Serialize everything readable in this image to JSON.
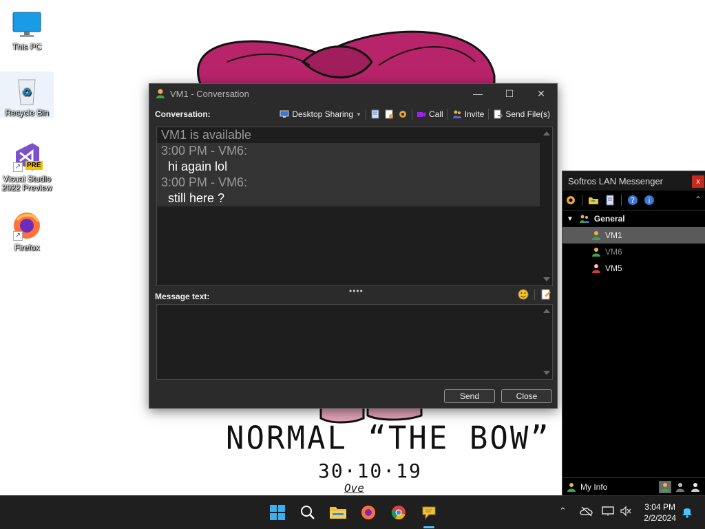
{
  "desktop": {
    "icons": [
      {
        "label": "This PC"
      },
      {
        "label": "Recycle Bin"
      },
      {
        "label": "Visual Studio 2022 Preview",
        "badge": "PRE"
      },
      {
        "label": "Firefox"
      }
    ]
  },
  "wallpaper": {
    "caption": "NORMAL “THE BOW”",
    "date": "30·10·19",
    "signature": "Ove"
  },
  "conversation_window": {
    "title": "VM1 - Conversation",
    "controls": {
      "minimize": "—",
      "maximize": "☐",
      "close": "✕"
    },
    "conversation_label": "Conversation:",
    "toolbar": {
      "desktop_sharing": "Desktop Sharing",
      "call": "Call",
      "invite": "Invite",
      "send_files": "Send File(s)"
    },
    "lines": {
      "status": "VM1 is available",
      "head1": "3:00 PM - VM6:",
      "msg1": "hi again lol",
      "head2": "3:00 PM - VM6:",
      "msg2": "still here ?"
    },
    "grip": "••••",
    "message_label": "Message text:",
    "message_value": "",
    "send_label": "Send",
    "close_label": "Close"
  },
  "lan_messenger": {
    "title": "Softros LAN Messenger",
    "close": "x",
    "group": "General",
    "contacts": [
      {
        "name": "VM1",
        "status": "available",
        "selected": true
      },
      {
        "name": "VM6",
        "status": "away",
        "selected": false
      },
      {
        "name": "VM5",
        "status": "busy",
        "selected": false
      }
    ],
    "my_info": "My Info"
  },
  "taskbar": {
    "apps": [
      "windows-start-icon",
      "search-icon",
      "file-explorer-icon",
      "firefox-icon",
      "chrome-icon",
      "lan-messenger-icon"
    ],
    "time": "3:04 PM",
    "date": "2/2/2024"
  },
  "colors": {
    "bow": "#b8246a",
    "window_bg": "#2b2b2b",
    "accent": "#4cc2ff"
  }
}
